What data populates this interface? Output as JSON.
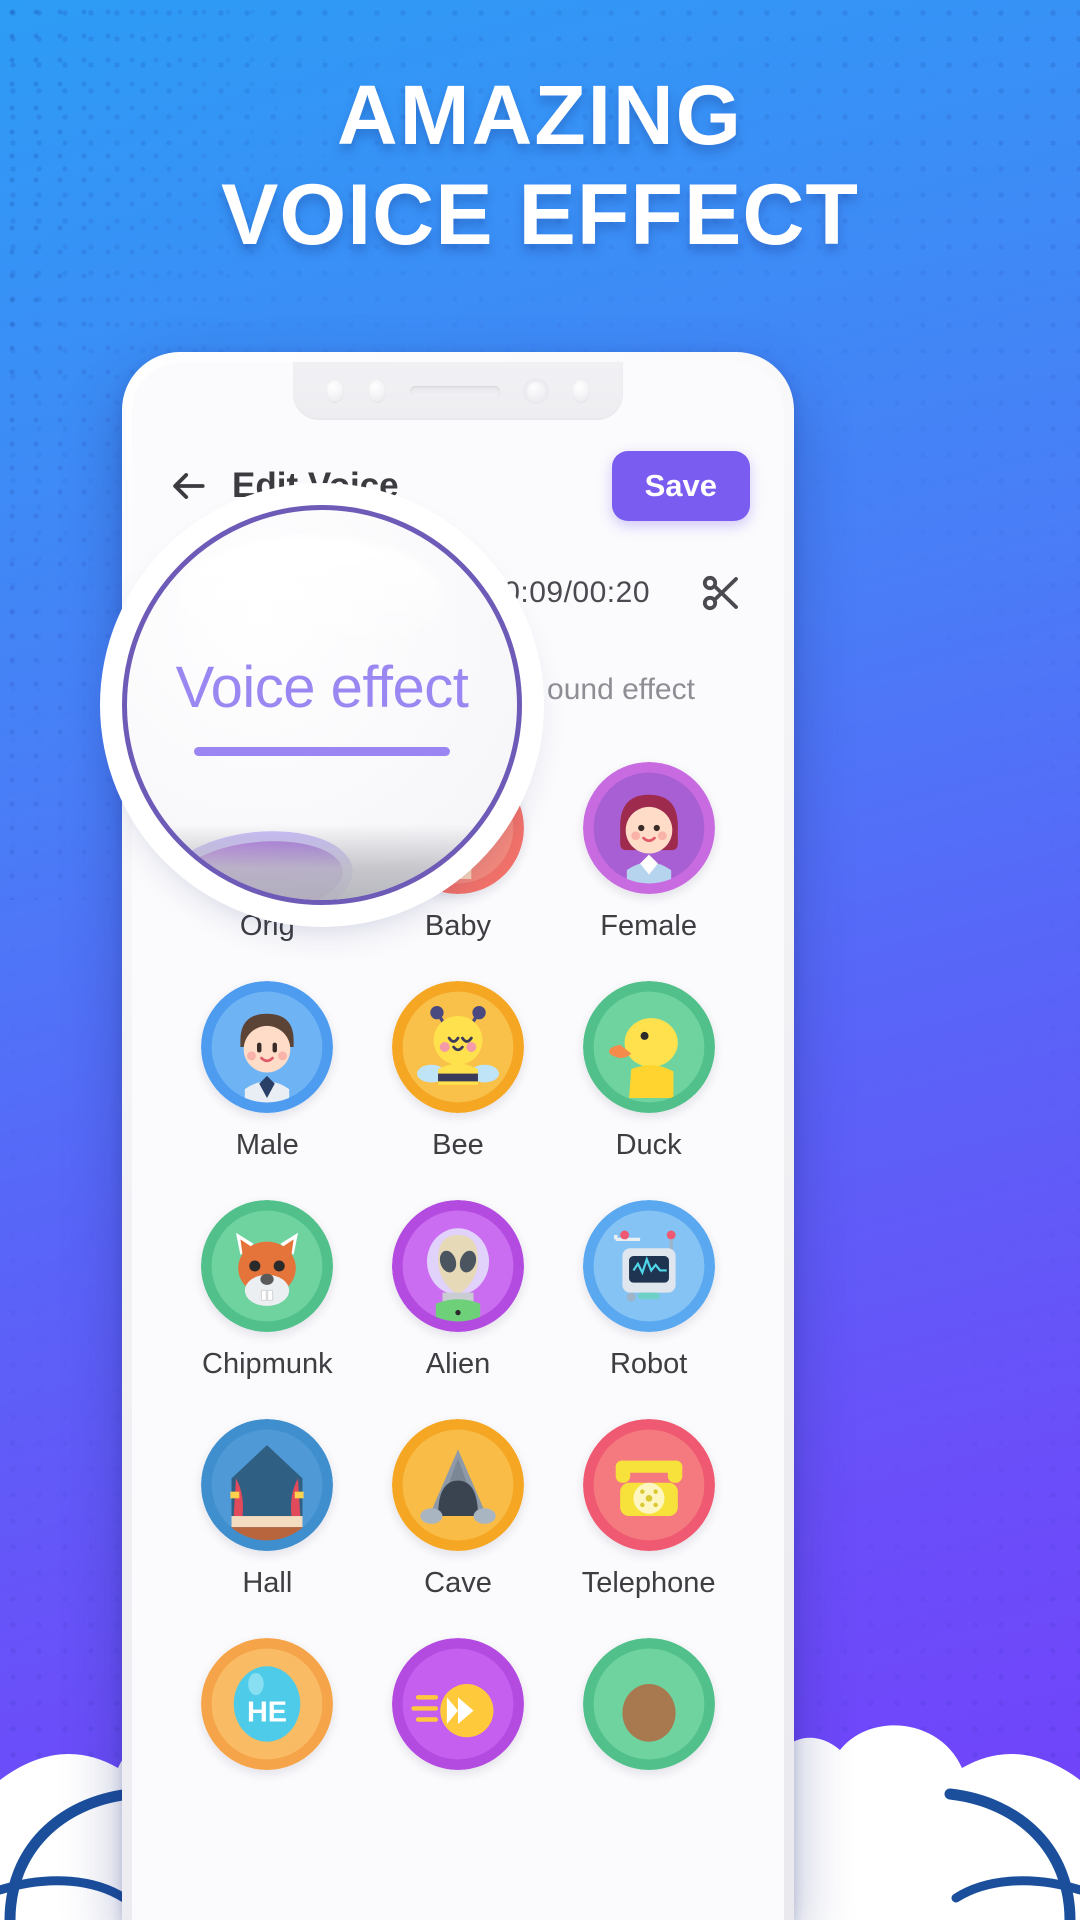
{
  "poster": {
    "headline_line1": "AMAZING",
    "headline_line2": "VOICE EFFECT",
    "background_colors": {
      "top": "#2d9cf5",
      "bottom": "#7240fb"
    }
  },
  "magnifier": {
    "label": "Voice effect",
    "border_color": "#6e5bb8",
    "text_color": "#9b87f2"
  },
  "app": {
    "appbar": {
      "back_icon": "arrow-left-icon",
      "title": "Edit Voice",
      "save_label": "Save",
      "save_color": "#7a5cf0"
    },
    "player": {
      "time_display": "00:09/00:20",
      "current_time": "00:09",
      "total_time": "00:20",
      "trim_icon": "scissors-icon"
    },
    "tabs": [
      {
        "label": "Voice effect",
        "active": true
      },
      {
        "label": "ound effect",
        "active": false
      }
    ],
    "effects": [
      {
        "label": "Orig",
        "icon": "original-icon",
        "ring": "#c8a2e8",
        "bg": "#b76fd8"
      },
      {
        "label": "Baby",
        "icon": "baby-icon",
        "ring": "#f2726a",
        "bg": "#f4897c"
      },
      {
        "label": "Female",
        "icon": "female-icon",
        "ring": "#c86be0",
        "bg": "#a85fd4"
      },
      {
        "label": "Male",
        "icon": "male-icon",
        "ring": "#4e9cf0",
        "bg": "#6eb4f5"
      },
      {
        "label": "Bee",
        "icon": "bee-icon",
        "ring": "#f5a623",
        "bg": "#f9c04a"
      },
      {
        "label": "Duck",
        "icon": "duck-icon",
        "ring": "#52c08a",
        "bg": "#6fd3a0"
      },
      {
        "label": "Chipmunk",
        "icon": "chipmunk-icon",
        "ring": "#52c08a",
        "bg": "#6fd3a0"
      },
      {
        "label": "Alien",
        "icon": "alien-icon",
        "ring": "#b44be0",
        "bg": "#cb6df0"
      },
      {
        "label": "Robot",
        "icon": "robot-icon",
        "ring": "#5aa8ef",
        "bg": "#85c3f5"
      },
      {
        "label": "Hall",
        "icon": "hall-icon",
        "ring": "#3f8fce",
        "bg": "#4f9ad6"
      },
      {
        "label": "Cave",
        "icon": "cave-icon",
        "ring": "#f5a623",
        "bg": "#f9bd47"
      },
      {
        "label": "Telephone",
        "icon": "telephone-icon",
        "ring": "#ef5a72",
        "bg": "#f47a7f"
      },
      {
        "label": "",
        "icon": "helium-icon",
        "ring": "#f6a44a",
        "bg": "#f9bb63"
      },
      {
        "label": "",
        "icon": "fast-icon",
        "ring": "#b44be0",
        "bg": "#c45ff0"
      },
      {
        "label": "",
        "icon": "monster-icon",
        "ring": "#52c08a",
        "bg": "#6fd3a0"
      }
    ]
  }
}
